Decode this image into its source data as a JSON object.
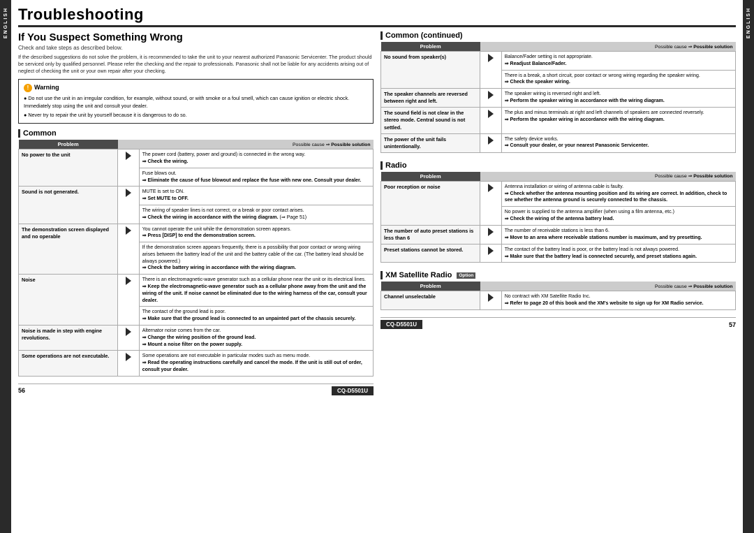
{
  "page": {
    "title": "Troubleshooting",
    "subtitle": "If You Suspect Something Wrong",
    "check_note": "Check and take steps as described below.",
    "body_text": "If the described suggestions do not solve the problem, it is recommended to take the unit to your nearest authorized Panasonic Servicenter. The product should be serviced only by qualified personnel. Please refer the checking and the repair to professionals. Panasonic shall not be liable for any accidents arising out of neglect of checking the unit or your own repair after your checking.",
    "left_page_num": "56",
    "right_page_num": "57",
    "model": "CQ-D5501U",
    "side_left": [
      "E",
      "N",
      "G",
      "L",
      "I",
      "S",
      "H"
    ],
    "side_right": [
      "E",
      "N",
      "G",
      "L",
      "I",
      "S",
      "H"
    ]
  },
  "warning": {
    "title": "Warning",
    "items": [
      "Do not use the unit in an irregular condition, for example, without sound, or with smoke or a foul smell, which can cause ignition or electric shock. Immediately stop using the unit and consult your dealer.",
      "Never try to repair the unit by yourself because it is dangerous to do so."
    ]
  },
  "common_section": {
    "title": "Common",
    "cause_solution_header": "Possible cause ⇒ Possible solution",
    "problems": [
      {
        "problem": "No power to the unit",
        "solutions": [
          "The power cord (battery, power and ground) is connected in the wrong way.\n⇒ Check the wiring.",
          "Fuse blows out.\n⇒ Eliminate the cause of fuse blowout and replace the fuse with new one. Consult your dealer."
        ]
      },
      {
        "problem": "Sound is not generated.",
        "solutions": [
          "MUTE is set to ON.\n⇒ Set MUTE to OFF.",
          "The wiring of speaker lines is not correct, or a break or poor contact arises.\n⇒ Check the wiring in accordance with the wiring diagram. (⇒ Page 51)"
        ]
      },
      {
        "problem": "The demonstration screen displayed and no operable",
        "solutions": [
          "You cannot operate the unit while the demonstration screen appears.\n⇒ Press [DISP] to end the demonstration screen.",
          "If the demonstration screen appears frequently, there is a possibility that poor contact or wrong wiring arises between the battery lead of the unit and the battery cable of the car. (The battery lead should be always powered.)\n⇒ Check the battery wiring in accordance with the wiring diagram."
        ]
      },
      {
        "problem": "Noise",
        "solutions": [
          "There is an electromagnetic-wave generator such as a cellular phone near the unit or its electrical lines.\n⇒ Keep the electromagnetic-wave generator such as a cellular phone away from the unit and the wiring of the unit. If noise cannot be eliminated due to the wiring harness of the car, consult your dealer.",
          "The contact of the ground lead is poor.\n⇒ Make sure that the ground lead is connected to an unpainted part of the chassis securely."
        ]
      },
      {
        "problem": "Noise is made in step with engine revolutions.",
        "solutions": [
          "Alternator noise comes from the car.\n⇒ Change the wiring position of the ground lead.\n⇒ Mount a noise filter on the power supply."
        ]
      },
      {
        "problem": "Some operations are not executable.",
        "solutions": [
          "Some operations are not executable in particular modes such as menu mode.\n⇒ Read the operating instructions carefully and cancel the mode. If the unit is still out of order, consult your dealer."
        ]
      }
    ]
  },
  "common_continued": {
    "title": "Common (continued)",
    "cause_solution_header": "Possible cause ⇒ Possible solution",
    "problems": [
      {
        "problem": "No sound from speaker(s)",
        "solutions": [
          "Balance/Fader setting is not appropriate.\n⇒ Readjust Balance/Fader.",
          "There is a break, a short circuit, poor contact or wrong wiring regarding the speaker wiring.\n⇒ Check the speaker wiring."
        ]
      },
      {
        "problem": "The speaker channels are reversed between right and left.",
        "solutions": [
          "The speaker wiring is reversed right and left.\n⇒ Perform the speaker wiring in accordance with the wiring diagram."
        ]
      },
      {
        "problem": "The sound field is not clear in the stereo mode. Central sound is not settled.",
        "solutions": [
          "The plus and minus terminals at right and left channels of speakers are connected reversely.\n⇒ Perform the speaker wiring in accordance with the wiring diagram."
        ]
      },
      {
        "problem": "The power of the unit fails unintentionally.",
        "solutions": [
          "The safety device works.\n⇒ Consult your dealer, or your nearest Panasonic Servicenter."
        ]
      }
    ]
  },
  "radio_section": {
    "title": "Radio",
    "cause_solution_header": "Possible cause ⇒ Possible solution",
    "problems": [
      {
        "problem": "Poor reception or noise",
        "solutions": [
          "Antenna installation or wiring of antenna cable is faulty.\n⇒ Check whether the antenna mounting position and its wiring are correct. In addition, check to see whether the antenna ground is securely connected to the chassis.",
          "No power is supplied to the antenna amplifier (when using a film antenna, etc.)\n⇒ Check the wiring of the antenna battery lead."
        ]
      },
      {
        "problem": "The number of auto preset stations is less than 6",
        "solutions": [
          "The number of receivable stations is less than 6.\n⇒ Move to an area where receivable stations number is maximum, and try presetting."
        ]
      },
      {
        "problem": "Preset stations cannot be stored.",
        "solutions": [
          "The contact of the battery lead is poor, or the battery lead is not always powered.\n⇒ Make sure that the battery lead is connected securely, and preset stations again."
        ]
      }
    ]
  },
  "xm_section": {
    "title": "XM Satellite Radio",
    "option_label": "Option",
    "cause_solution_header": "Possible cause ⇒ Possible solution",
    "problems": [
      {
        "problem": "Channel unselectable",
        "solutions": [
          "No contract with XM Satellite Radio Inc.\n⇒ Refer to page 20 of this book and the XM's website to sign up for XM Radio service."
        ]
      }
    ]
  }
}
